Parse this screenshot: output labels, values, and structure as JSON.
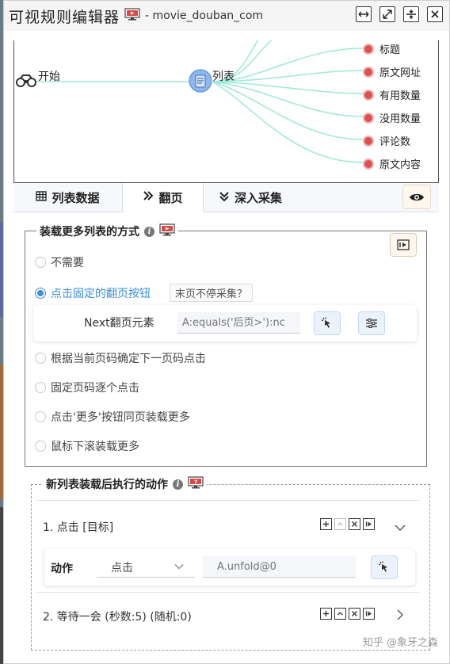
{
  "window": {
    "title": "可视规则编辑器",
    "subtitle": "- movie_douban_com",
    "buttons": [
      "fit-width",
      "fullscreen",
      "split",
      "close"
    ]
  },
  "mindmap": {
    "start_label": "开始",
    "list_label": "列表",
    "leaves": [
      "标题",
      "原文网址",
      "有用数量",
      "没用数量",
      "评论数",
      "原文内容"
    ],
    "line_color": "#9ee8d8"
  },
  "tabs": [
    {
      "label": "列表数据",
      "icon": "table-icon",
      "active": false
    },
    {
      "label": "翻页",
      "icon": "double-chevron-right-icon",
      "active": true
    },
    {
      "label": "深入采集",
      "icon": "double-chevron-down-icon",
      "active": false
    }
  ],
  "paging": {
    "legend": "装载更多列表的方式",
    "options": [
      {
        "label": "不需要",
        "selected": false
      },
      {
        "label": "点击固定的翻页按钮",
        "selected": true
      },
      {
        "label": "根据当前页码确定下一页码点击",
        "selected": false
      },
      {
        "label": "固定页码逐个点击",
        "selected": false
      },
      {
        "label": "点击'更多'按钮同页装载更多",
        "selected": false
      },
      {
        "label": "鼠标下滚装载更多",
        "selected": false
      }
    ],
    "nonstop_tag": "末页不停采集？",
    "next_label": "Next翻页元素",
    "next_placeholder": "A:equals('后页>'):nc"
  },
  "actions": {
    "legend": "新列表装载后执行的动作",
    "items": [
      {
        "label": "1. 点击 [目标]"
      },
      {
        "label": "2. 等待一会 (秒数:5) (随机:0)"
      }
    ],
    "detail": {
      "label": "动作",
      "select_value": "点击",
      "input_placeholder": "A.unfold@0"
    }
  },
  "colors": {
    "accent": "#3b8fdc",
    "leaf_dot": "#e05050"
  },
  "watermark": "知乎 @象牙之森"
}
